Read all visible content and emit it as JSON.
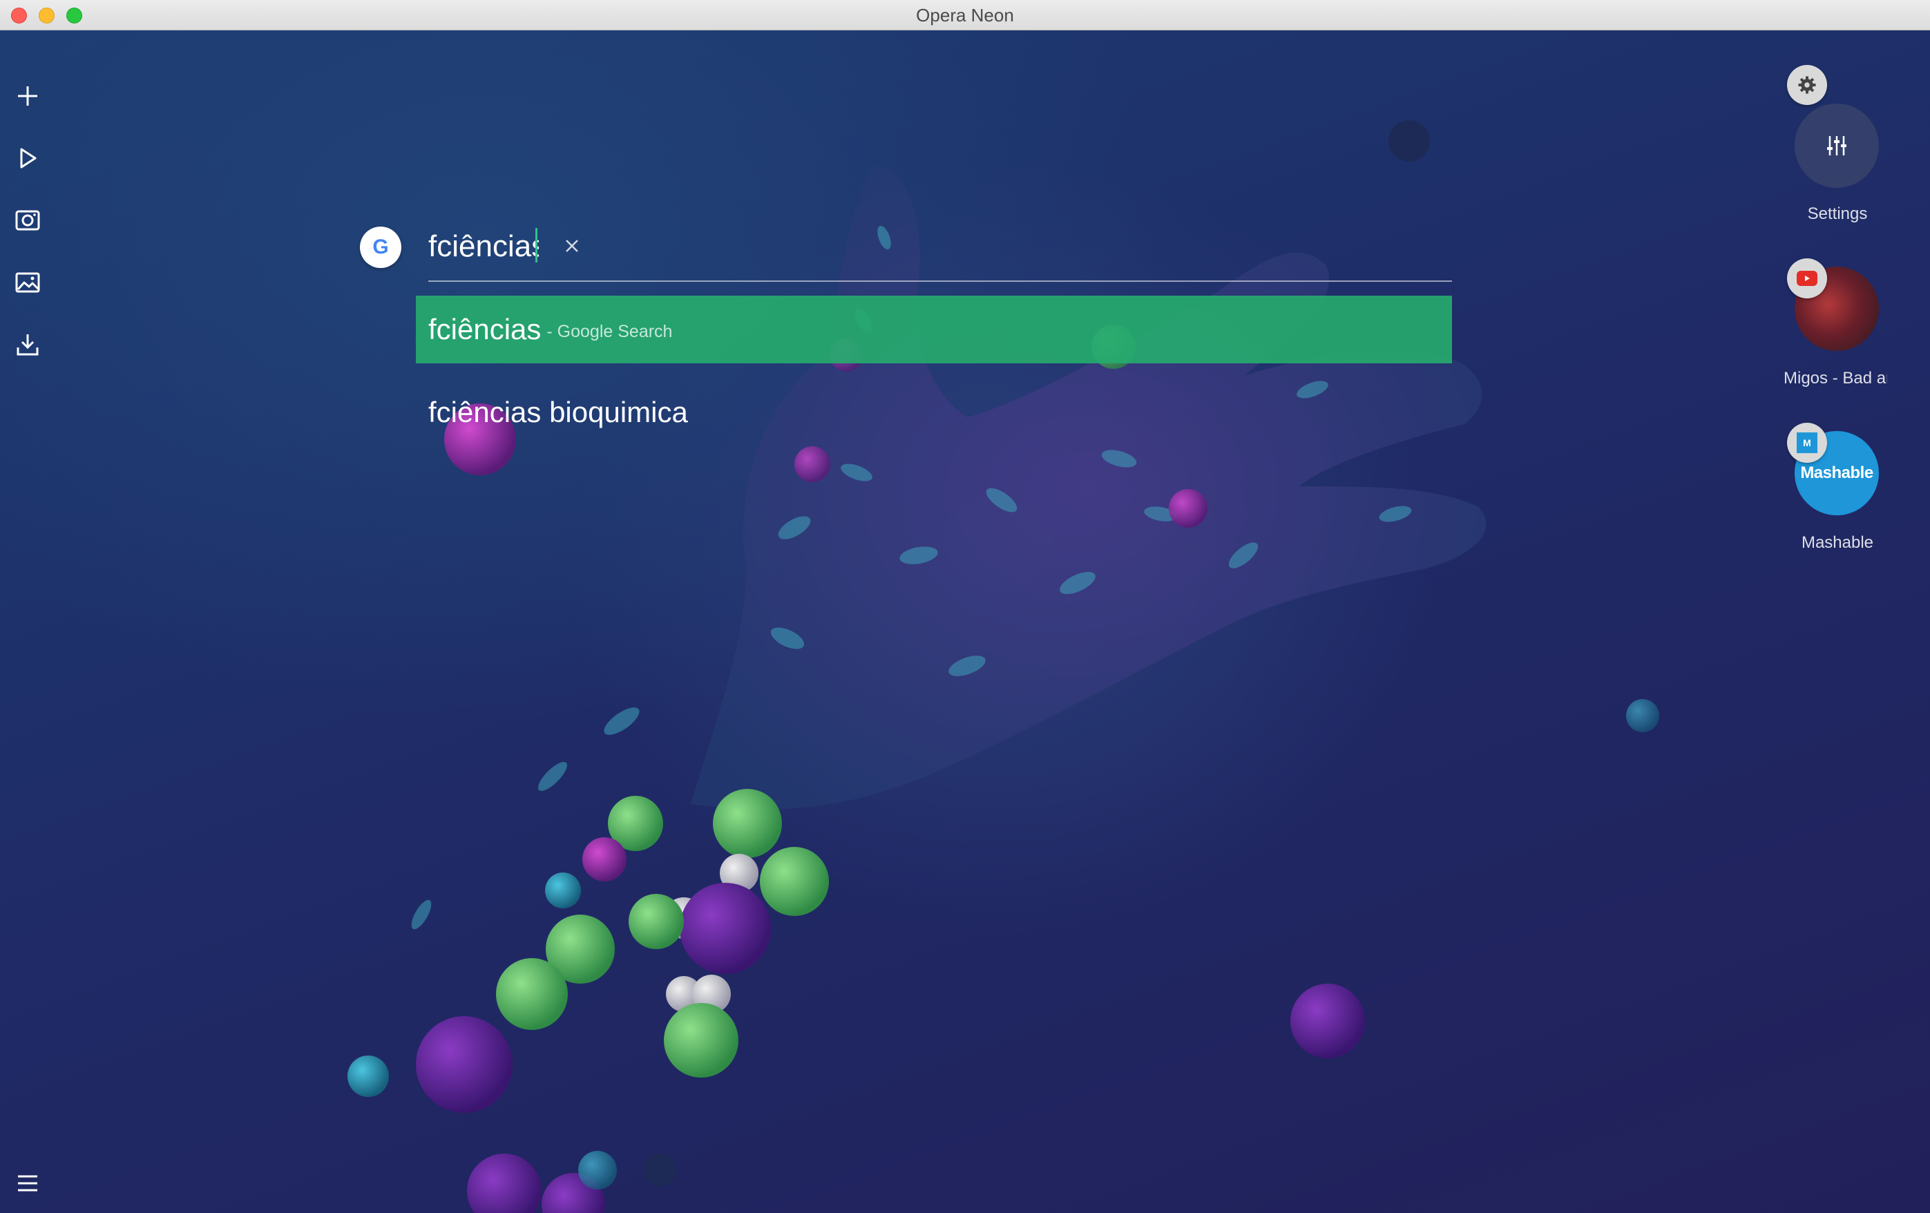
{
  "window": {
    "title": "Opera Neon"
  },
  "sidebar": {
    "items": [
      {
        "name": "new-tab",
        "icon": "plus-icon"
      },
      {
        "name": "media-player",
        "icon": "play-icon"
      },
      {
        "name": "snapshot",
        "icon": "camera-icon"
      },
      {
        "name": "gallery",
        "icon": "image-icon"
      },
      {
        "name": "downloads",
        "icon": "download-icon"
      },
      {
        "name": "menu",
        "icon": "hamburger-menu-icon"
      }
    ]
  },
  "search": {
    "engine_icon": "google-icon",
    "engine_letter": "G",
    "query": "fciências",
    "clear_icon": "close-icon",
    "suggestions": [
      {
        "text": "fciências",
        "hint": "- Google Search",
        "selected": true
      },
      {
        "text": "fciências bioquimica",
        "hint": "",
        "selected": false
      }
    ]
  },
  "tiles": [
    {
      "label": "Settings",
      "badge_icon": "gear-icon",
      "icon": "sliders-icon"
    },
    {
      "label": "Migos - Bad and Boujee",
      "badge_icon": "youtube-icon"
    },
    {
      "label": "Mashable",
      "badge_icon": "mashable-icon",
      "logo_text": "Mashable",
      "badge_letter": "M"
    }
  ],
  "colors": {
    "accent": "#26aa6e",
    "background": "#1f2a66",
    "mashable": "#1e96d8"
  }
}
